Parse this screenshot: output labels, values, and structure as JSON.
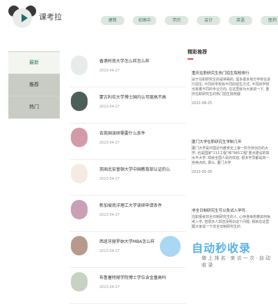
{
  "header": {
    "brand": "课考拉",
    "nav": [
      "建筑",
      "初高中",
      "学历",
      "会计",
      "英语",
      "医药"
    ]
  },
  "sidebar": {
    "tabs": [
      "最新",
      "推荐",
      "热门"
    ]
  },
  "articles": [
    {
      "title": "香港岭南大学怎么样怎么样",
      "date": "2023-04-27",
      "avatar_color": "#e8ece8"
    },
    {
      "title": "蒙古利坎大学博士国内认可度高不高",
      "date": "2023-04-27",
      "avatar_color": "#4c5f59"
    },
    {
      "title": "去英国读研需要什么条件",
      "date": "2023-04-27",
      "avatar_color": "#d59aa8"
    },
    {
      "title": "英国北安普顿大学中国教育部认证的么",
      "date": "2023-04-27",
      "avatar_color": "#f4ece2"
    },
    {
      "title": "新加坡南洋理工大学读研申请条件",
      "date": "2023-04-27",
      "avatar_color": "#caa0b5"
    },
    {
      "title": "西班牙赫罗纳大学MBA怎么样",
      "date": "2023-04-27",
      "avatar_color": "#b79a8c"
    },
    {
      "title": "布鲁塞特赫学院博士学位含金量高吗",
      "date": "2023-04-27",
      "avatar_color": "#c7d2c2"
    }
  ],
  "right": {
    "title": "精彩推荐",
    "cards": [
      {
        "title": "重庆在职研究生热门招生院校排行",
        "body": "由于在职研究生的是特殊的, 需多很多地方学校在进行招生, 不同的学校有不同的招生方式, 不同的学校也有着不同的专业方向, 在这里就为大家讲一下, 重庆在职研究生的热门招生院校都",
        "date": "2022-08-25"
      },
      {
        "title": "厦门大学在职研究生学制几年",
        "body": "厦门大学是中国近代教育史上第一所华侨创办的大学, 也是国家\"211工程\"和\"985工程\"重点建设的高水平大学, 现就全国人民的欢迎, 很多学员都是高一些特点的, 那么, 厦门大学",
        "date": "2022-05-30"
      },
      {
        "title": "非全日制研究生可以免试入学吗",
        "body": "在职报考非全日制研究生的人, 心存侥幸想着如何免考入学, 但很多人却还没明白这个问题, 我就在这里跟大家说一下非全日制研究生的",
        "date": ""
      }
    ]
  },
  "watermark": {
    "main": "自动秒收录",
    "sub": "做 上 排 名 · 来 访 一 次 · 自 动 收 录"
  }
}
